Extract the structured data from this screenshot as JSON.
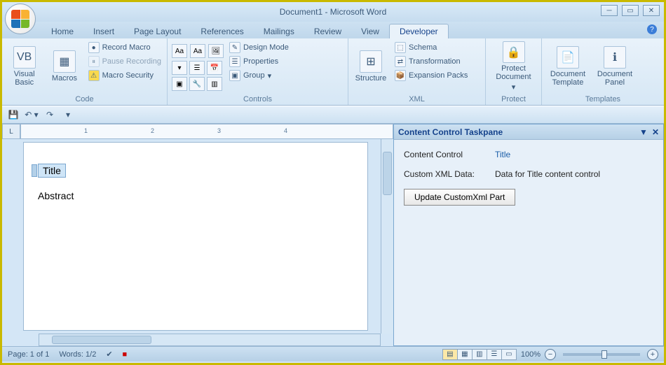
{
  "title": "Document1 - Microsoft Word",
  "tabs": [
    "Home",
    "Insert",
    "Page Layout",
    "References",
    "Mailings",
    "Review",
    "View",
    "Developer"
  ],
  "active_tab": "Developer",
  "ribbon": {
    "code": {
      "label": "Code",
      "visual_basic": "Visual Basic",
      "macros": "Macros",
      "record_macro": "Record Macro",
      "pause_recording": "Pause Recording",
      "macro_security": "Macro Security"
    },
    "controls": {
      "label": "Controls",
      "design_mode": "Design Mode",
      "properties": "Properties",
      "group": "Group"
    },
    "xml": {
      "label": "XML",
      "structure": "Structure",
      "schema": "Schema",
      "transformation": "Transformation",
      "expansion_packs": "Expansion Packs"
    },
    "protect": {
      "label": "Protect",
      "protect_document": "Protect Document"
    },
    "templates": {
      "label": "Templates",
      "document_template": "Document Template",
      "document_panel": "Document Panel"
    }
  },
  "document": {
    "content_control_text": "Title",
    "abstract_text": "Abstract"
  },
  "taskpane": {
    "title": "Content Control Taskpane",
    "cc_label": "Content Control",
    "cc_value": "Title",
    "xml_label": "Custom XML Data:",
    "xml_value": "Data for Title content control",
    "button": "Update CustomXml Part"
  },
  "status": {
    "page": "Page: 1 of 1",
    "words": "Words: 1/2",
    "zoom": "100%"
  },
  "ruler_marks": [
    "1",
    "2",
    "3",
    "4"
  ]
}
